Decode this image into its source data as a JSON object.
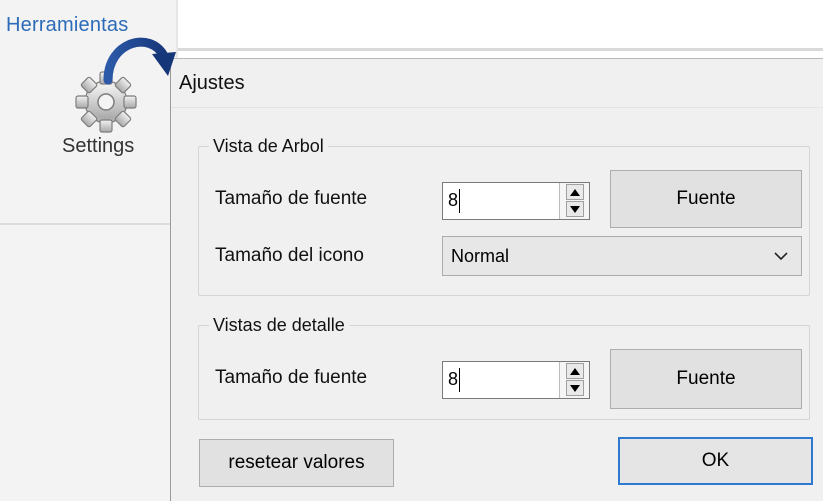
{
  "ribbon": {
    "tab_label": "Herramientas",
    "settings_label": "Settings"
  },
  "dialog": {
    "title": "Ajustes",
    "tree_view": {
      "legend": "Vista de Arbol",
      "font_size_label": "Tamaño de fuente",
      "font_size_value": "8",
      "font_button": "Fuente",
      "icon_size_label": "Tamaño del icono",
      "icon_size_value": "Normal"
    },
    "detail_view": {
      "legend": "Vistas de detalle",
      "font_size_label": "Tamaño de fuente",
      "font_size_value": "8",
      "font_button": "Fuente"
    },
    "reset_button": "resetear valores",
    "ok_button": "OK"
  },
  "icons": {
    "settings": "gear-icon",
    "arrow": "curved-arrow-icon",
    "spin_up": "spin-up-icon",
    "spin_down": "spin-down-icon",
    "dropdown": "chevron-down-icon"
  },
  "colors": {
    "accent": "#2e7ad1",
    "tab_text": "#2b6bb8",
    "arrow": "#1e3f86"
  }
}
